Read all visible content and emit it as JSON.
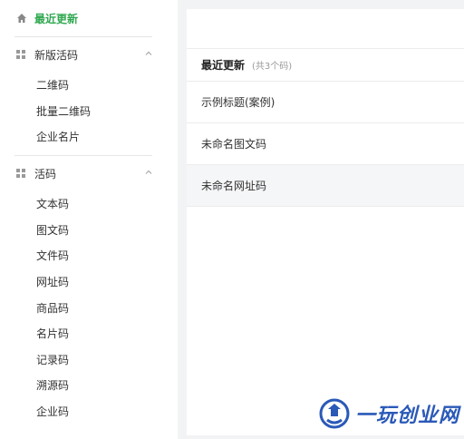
{
  "sidebar": {
    "top_label": "最近更新",
    "groups": [
      {
        "label": "新版活码",
        "items": [
          "二维码",
          "批量二维码",
          "企业名片"
        ]
      },
      {
        "label": "活码",
        "items": [
          "文本码",
          "图文码",
          "文件码",
          "网址码",
          "商品码",
          "名片码",
          "记录码",
          "溯源码",
          "企业码"
        ]
      }
    ]
  },
  "main": {
    "list_title": "最近更新",
    "list_count": "(共3个码)",
    "rows": [
      "示例标题(案例)",
      "未命名图文码",
      "未命名网址码"
    ]
  },
  "watermark": {
    "text": "一玩创业网"
  },
  "colors": {
    "accent": "#2fa84f",
    "watermark": "#2a59b8"
  }
}
